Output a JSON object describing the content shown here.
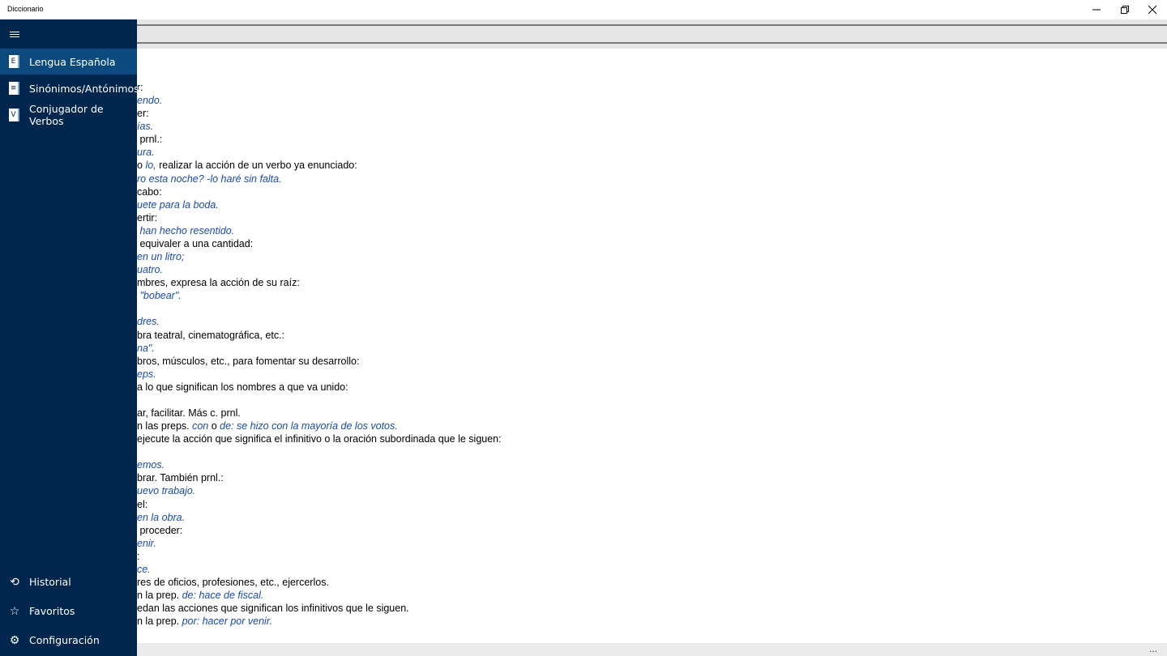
{
  "window": {
    "title": "Diccionario",
    "minimize": "—",
    "restore": "❐",
    "close": "✕"
  },
  "search": {
    "value": "",
    "placeholder": ""
  },
  "sidebar": {
    "menu_icon": "hamburger-icon",
    "items": [
      {
        "label": "Lengua Española",
        "badge": "E",
        "icon": "book-e-icon",
        "active": true
      },
      {
        "label": "Sinónimos/Antónimos",
        "badge": "≡",
        "icon": "book-thesaurus-icon",
        "active": false
      },
      {
        "label": "Conjugador de Verbos",
        "badge": "V",
        "icon": "book-v-icon",
        "active": false
      }
    ],
    "bottom_items": [
      {
        "label": "Historial",
        "icon": "history-icon",
        "glyph": "⟲"
      },
      {
        "label": "Favoritos",
        "icon": "star-icon",
        "glyph": "☆"
      },
      {
        "label": "Configuración",
        "icon": "gear-icon",
        "glyph": "⚙"
      }
    ]
  },
  "definition_lines": [
    {
      "parts": [
        {
          "t": "r:",
          "i": false
        }
      ]
    },
    {
      "parts": [
        {
          "t": "endo.",
          "i": true
        }
      ]
    },
    {
      "parts": [
        {
          "t": "er:",
          "i": false
        }
      ]
    },
    {
      "parts": [
        {
          "t": "ías.",
          "i": true
        }
      ]
    },
    {
      "parts": [
        {
          "t": " prnl.:",
          "i": false
        }
      ]
    },
    {
      "parts": [
        {
          "t": "ura.",
          "i": true
        }
      ]
    },
    {
      "parts": [
        {
          "t": "o ",
          "i": false
        },
        {
          "t": "lo,",
          "i": true
        },
        {
          "t": " realizar la acción de un verbo ya enunciado:",
          "i": false
        }
      ]
    },
    {
      "parts": [
        {
          "t": "ro esta noche? -lo haré sin falta.",
          "i": true
        }
      ]
    },
    {
      "parts": [
        {
          "t": "cabo:",
          "i": false
        }
      ]
    },
    {
      "parts": [
        {
          "t": "uete para la boda.",
          "i": true
        }
      ]
    },
    {
      "parts": [
        {
          "t": "ertir:",
          "i": false
        }
      ]
    },
    {
      "parts": [
        {
          "t": " han hecho resentido.",
          "i": true
        }
      ]
    },
    {
      "parts": [
        {
          "t": " equivaler a una cantidad:",
          "i": false
        }
      ]
    },
    {
      "parts": [
        {
          "t": "en un litro;",
          "i": true
        }
      ]
    },
    {
      "parts": [
        {
          "t": "uatro.",
          "i": true
        }
      ]
    },
    {
      "parts": [
        {
          "t": "mbres, expresa la acción de su raíz:",
          "i": false
        }
      ]
    },
    {
      "parts": [
        {
          "t": " \"bobear\".",
          "i": true
        }
      ]
    },
    {
      "parts": [
        {
          "t": "",
          "i": false
        }
      ]
    },
    {
      "parts": [
        {
          "t": "dres.",
          "i": true
        }
      ]
    },
    {
      "parts": [
        {
          "t": "bra teatral, cinematográfica, etc.:",
          "i": false
        }
      ]
    },
    {
      "parts": [
        {
          "t": "na\".",
          "i": true
        }
      ]
    },
    {
      "parts": [
        {
          "t": "bros, músculos, etc., para fomentar su desarrollo:",
          "i": false
        }
      ]
    },
    {
      "parts": [
        {
          "t": "eps.",
          "i": true
        }
      ]
    },
    {
      "parts": [
        {
          "t": "a lo que significan los nombres a que va unido:",
          "i": false
        }
      ]
    },
    {
      "parts": [
        {
          "t": "",
          "i": false
        }
      ]
    },
    {
      "parts": [
        {
          "t": "ar, facilitar. Más c. prnl.",
          "i": false
        }
      ]
    },
    {
      "parts": [
        {
          "t": "n las preps. ",
          "i": false
        },
        {
          "t": "con",
          "i": true
        },
        {
          "t": " o ",
          "i": false
        },
        {
          "t": "de: se hizo con la mayoría de los votos.",
          "i": true
        }
      ]
    },
    {
      "parts": [
        {
          "t": "ejecute la acción que significa el infinitivo o la oración subordinada que le siguen:",
          "i": false
        }
      ]
    },
    {
      "parts": [
        {
          "t": "",
          "i": false
        }
      ]
    },
    {
      "parts": [
        {
          "t": "emos.",
          "i": true
        }
      ]
    },
    {
      "parts": [
        {
          "t": "brar. También prnl.:",
          "i": false
        }
      ]
    },
    {
      "parts": [
        {
          "t": "uevo trabajo.",
          "i": true
        }
      ]
    },
    {
      "parts": [
        {
          "t": "el:",
          "i": false
        }
      ]
    },
    {
      "parts": [
        {
          "t": "en la obra.",
          "i": true
        }
      ]
    },
    {
      "parts": [
        {
          "t": " proceder:",
          "i": false
        }
      ]
    },
    {
      "parts": [
        {
          "t": "enir.",
          "i": true
        }
      ]
    },
    {
      "parts": [
        {
          "t": ":",
          "i": false
        }
      ]
    },
    {
      "parts": [
        {
          "t": "ce.",
          "i": true
        }
      ]
    },
    {
      "parts": [
        {
          "t": "res de oficios, profesiones, etc., ejercerlos.",
          "i": false
        }
      ]
    },
    {
      "parts": [
        {
          "t": "n la prep. ",
          "i": false
        },
        {
          "t": "de: hace de fiscal.",
          "i": true
        }
      ]
    },
    {
      "parts": [
        {
          "t": "edan las acciones que significan los infinitivos que le siguen.",
          "i": false
        }
      ]
    },
    {
      "parts": [
        {
          "t": "n la prep. ",
          "i": false
        },
        {
          "t": "por: hacer por venir.",
          "i": true
        }
      ]
    }
  ],
  "bottom_bar": {
    "more": "..."
  }
}
